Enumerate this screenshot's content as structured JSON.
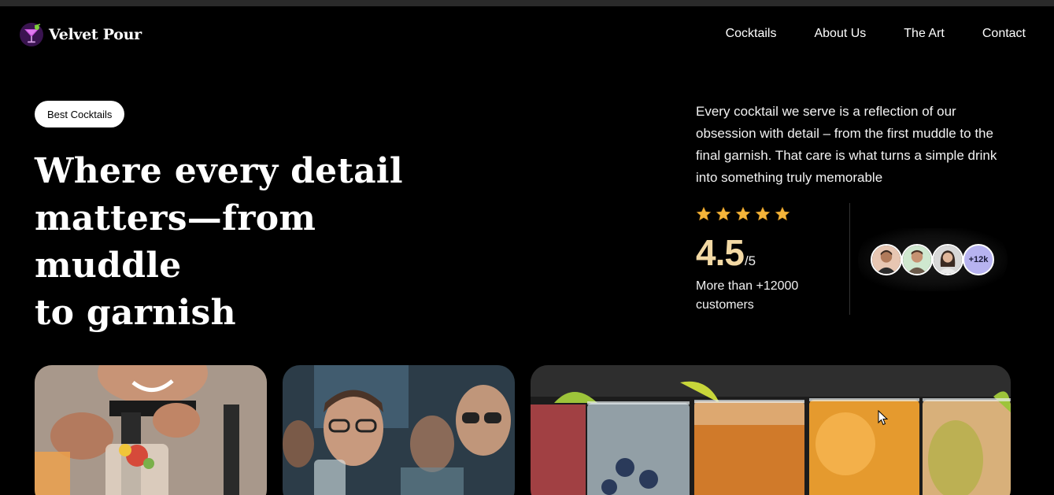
{
  "brand": {
    "name": "Velvet Pour",
    "logo_icon": "cocktail-glass-icon"
  },
  "nav": {
    "links": [
      "Cocktails",
      "About Us",
      "The Art",
      "Contact"
    ]
  },
  "hero": {
    "badge": "Best Cocktails",
    "headline_line1": "Where every detail",
    "headline_line2": "matters—from muddle",
    "headline_line3": "to garnish",
    "description": "Every cocktail we serve is a reflection of our obsession with detail – from the first muddle to the final garnish. That care is what turns a simple drink into something truly memorable"
  },
  "rating": {
    "stars": 5,
    "value": "4.5",
    "total": "/5",
    "customers_text": "More than +12000 customers",
    "star_color": "#f5b53a",
    "value_color": "#f3d9a4"
  },
  "avatars": {
    "count_label": "+12k",
    "count_color": "#b7b3f0"
  },
  "gallery": {
    "images": [
      "bartender-garnishing-photo",
      "friends-toasting-photo",
      "cocktail-glasses-row-photo"
    ]
  }
}
